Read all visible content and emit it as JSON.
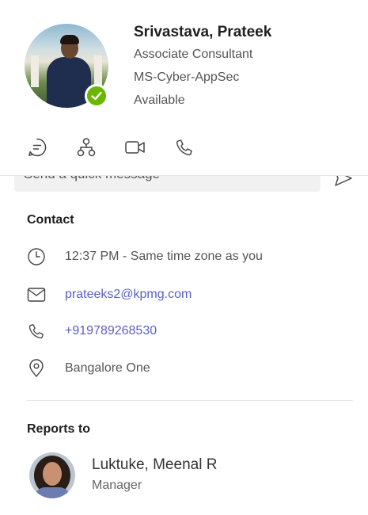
{
  "profile": {
    "name": "Srivastava, Prateek",
    "title": "Associate Consultant",
    "department": "MS-Cyber-AppSec",
    "status": "Available",
    "status_color": "#6bb700"
  },
  "actions": [
    {
      "icon": "chat-icon"
    },
    {
      "icon": "org-chart-icon"
    },
    {
      "icon": "video-call-icon"
    },
    {
      "icon": "phone-call-icon"
    }
  ],
  "quick_message": {
    "placeholder": "Send a quick message"
  },
  "contact": {
    "heading": "Contact",
    "local_time": "12:37 PM - Same time zone as you",
    "email": "prateeks2@kpmg.com",
    "phone": "+919789268530",
    "location": "Bangalore One"
  },
  "reports_to": {
    "heading": "Reports to",
    "name": "Luktuke, Meenal R",
    "role": "Manager"
  },
  "colors": {
    "link": "#5b5fc7",
    "icon": "#424242"
  }
}
